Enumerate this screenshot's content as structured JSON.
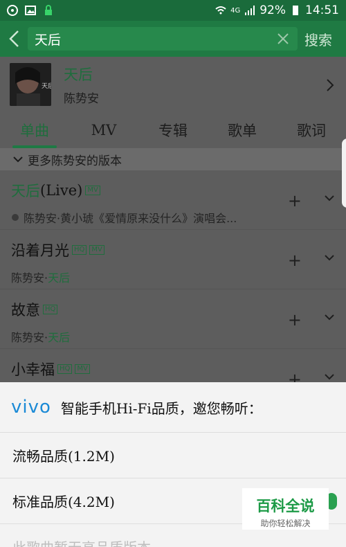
{
  "status": {
    "network": "4G",
    "battery": "92%",
    "time": "14:51"
  },
  "search": {
    "query": "天后",
    "submit_label": "搜索"
  },
  "artist_card": {
    "title": "天后",
    "artist": "陈势安"
  },
  "tabs": [
    {
      "label": "单曲",
      "active": true
    },
    {
      "label": "MV",
      "active": false
    },
    {
      "label": "专辑",
      "active": false
    },
    {
      "label": "歌单",
      "active": false
    },
    {
      "label": "歌词",
      "active": false
    }
  ],
  "more_versions": "更多陈势安的版本",
  "songs": [
    {
      "title": "天后 (Live)",
      "title_green": "天后",
      "title_rest": " (Live)",
      "badges": [
        "MV"
      ],
      "subtitle_prefix": "陈势安·黄小琥《爱情原来没什么》演唱会...",
      "subtitle_green": ""
    },
    {
      "title_green": "",
      "title_rest": "沿着月光",
      "badges": [
        "HQ",
        "MV"
      ],
      "subtitle_prefix": "陈势安·",
      "subtitle_green": "天后"
    },
    {
      "title_green": "",
      "title_rest": "故意",
      "badges": [
        "HQ"
      ],
      "subtitle_prefix": "陈势安·",
      "subtitle_green": "天后"
    },
    {
      "title_green": "",
      "title_rest": "小幸福",
      "badges": [
        "HQ",
        "MV"
      ],
      "subtitle_prefix": "",
      "subtitle_green": ""
    }
  ],
  "sheet": {
    "brand": "vivo",
    "title": "智能手机Hi-Fi品质，邀您畅听：",
    "options": [
      "流畅品质(1.2M)",
      "标准品质(4.2M)",
      "此歌曲暂无高品质版本"
    ]
  },
  "watermark": {
    "title": "百科全说",
    "subtitle": "助你轻松解决"
  },
  "colors": {
    "brand_green": "#1f7a43",
    "accent_blue": "#1b8ad6"
  }
}
